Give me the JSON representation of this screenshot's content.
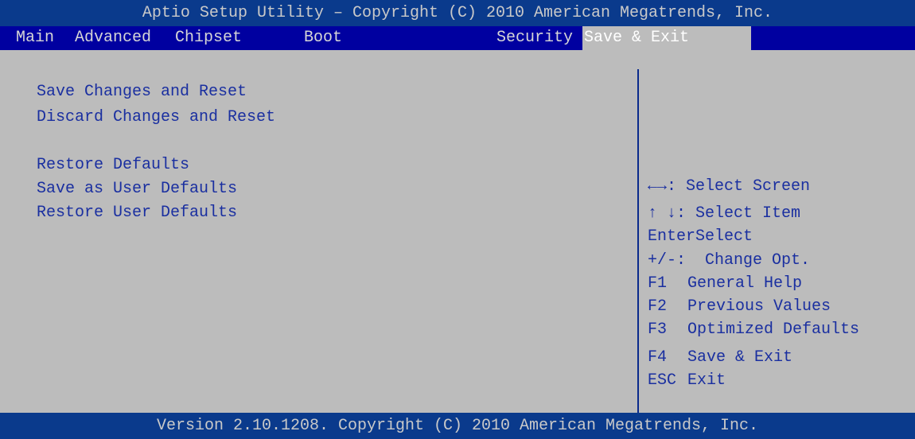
{
  "header": {
    "title": "Aptio Setup Utility – Copyright (C) 2010 American Megatrends, Inc."
  },
  "tabs": [
    {
      "label": "Main"
    },
    {
      "label": "Advanced"
    },
    {
      "label": "Chipset"
    },
    {
      "label": "Boot"
    },
    {
      "label": "Security"
    },
    {
      "label": "Save & Exit",
      "active": true
    }
  ],
  "menu": {
    "items": [
      {
        "label": "Save Changes and Reset"
      },
      {
        "label": "Discard Changes and Reset"
      },
      {
        "label": "Restore Defaults"
      },
      {
        "label": "Save as User Defaults"
      },
      {
        "label": "Restore User Defaults"
      }
    ]
  },
  "help": {
    "lines": [
      {
        "key": "←→",
        "text": ": Select Screen"
      },
      {
        "key": "↑ ↓",
        "text": ": Select Item"
      },
      {
        "key": "Enter",
        "text": "Select"
      },
      {
        "key": "+/-",
        "text": ":  Change Opt."
      },
      {
        "key": "F1",
        "text": "General Help"
      },
      {
        "key": "F2",
        "text": "Previous Values"
      },
      {
        "key": "F3",
        "text": "Optimized Defaults"
      },
      {
        "key": "F4",
        "text": "Save & Exit"
      },
      {
        "key": "ESC",
        "text": "Exit"
      }
    ]
  },
  "footer": {
    "text": "Version 2.10.1208. Copyright (C) 2010 American Megatrends, Inc."
  },
  "colors": {
    "background": "#bcbcbc",
    "header_bg": "#0a3a8c",
    "tab_bg": "#0000a0",
    "text_blue": "#1a2fa0"
  }
}
